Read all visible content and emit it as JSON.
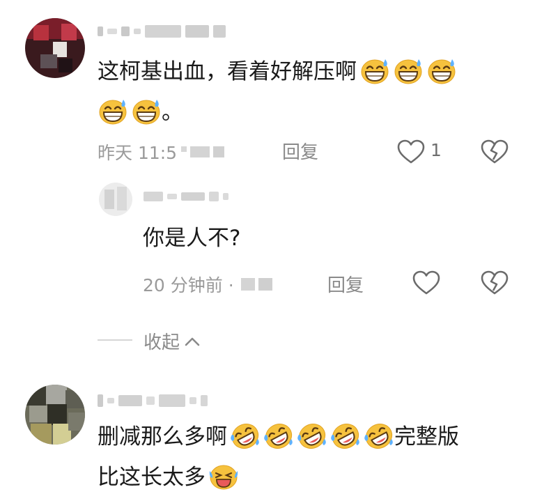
{
  "comments": [
    {
      "text_line1": "这柯基出血，看着好解压啊",
      "text_line2_tail": "。",
      "time": "昨天 11:5",
      "reply_label": "回复",
      "like_count": "1"
    }
  ],
  "reply": {
    "text": "你是人不?",
    "time": "20 分钟前 ·",
    "reply_label": "回复"
  },
  "collapse_label": "收起",
  "comment2": {
    "text_line1_head": "删减那么多啊",
    "text_line1_tail": "完整版",
    "text_line2": "比这长太多"
  },
  "colors": {
    "emoji_yellow": "#f6c23e",
    "meta_gray": "#9a9a9a"
  },
  "icons": [
    "grin-sweat-emoji",
    "rofl-emoji",
    "laugh-sweat-emoji",
    "heart-icon",
    "broken-heart-icon",
    "chevron-up-icon"
  ]
}
